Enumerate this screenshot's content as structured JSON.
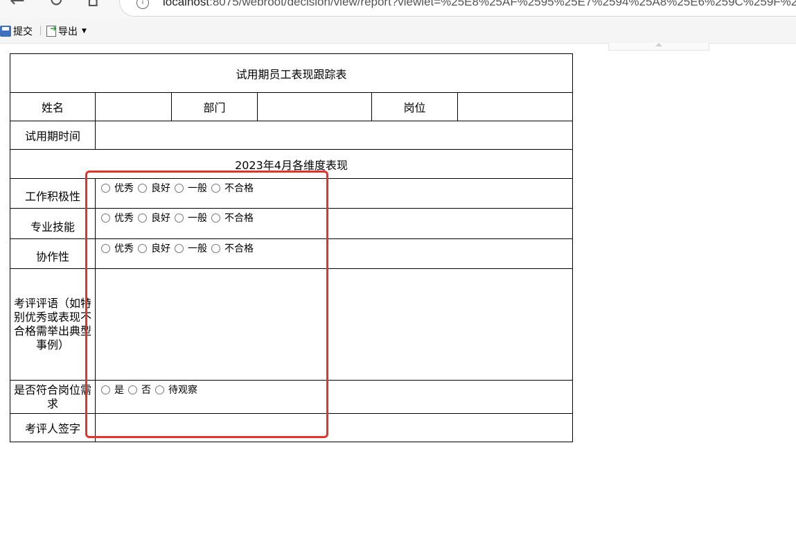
{
  "browser": {
    "url_host": "localhost",
    "url_path": ":8075/webroot/decision/view/report?viewlet=%25E8%25AF%2595%25E7%2594%25A8%25E6%259C%259F%2"
  },
  "toolbar": {
    "submit_label": "提交",
    "export_label": "导出"
  },
  "report": {
    "title": "试用期员工表现跟踪表",
    "name_label": "姓名",
    "dept_label": "部门",
    "position_label": "岗位",
    "probation_label": "试用期时间",
    "section_title": "2023年4月各维度表现",
    "criteria": [
      {
        "label": "工作积极性",
        "options": [
          "优秀",
          "良好",
          "一般",
          "不合格"
        ]
      },
      {
        "label": "专业技能",
        "options": [
          "优秀",
          "良好",
          "一般",
          "不合格"
        ]
      },
      {
        "label": "协作性",
        "options": [
          "优秀",
          "良好",
          "一般",
          "不合格"
        ]
      }
    ],
    "comment_label": "考评评语（如特别优秀或表现不合格需举出典型事例）",
    "fit_label": "是否符合岗位需求",
    "fit_options": [
      "是",
      "否",
      "待观察"
    ],
    "signature_label": "考评人签字"
  },
  "colors": {
    "highlight": "#e6332a"
  }
}
